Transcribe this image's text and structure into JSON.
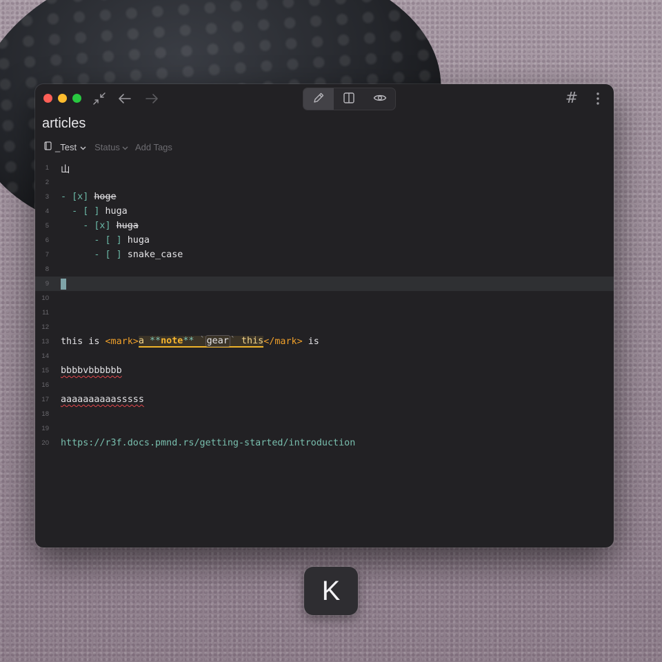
{
  "window": {
    "title": "articles"
  },
  "toolbar": {
    "icons": [
      "collapse-icon",
      "back-arrow-icon",
      "forward-arrow-icon",
      "pencil-icon",
      "split-view-icon",
      "eye-icon",
      "hashtag-icon",
      "more-vertical-icon"
    ],
    "hash_glyph": "#"
  },
  "meta": {
    "notebook": "_Test",
    "status": "Status",
    "tags": "Add Tags"
  },
  "editor": {
    "line_numbers": [
      "1",
      "2",
      "3",
      "4",
      "5",
      "6",
      "7",
      "8",
      "9",
      "10",
      "11",
      "12",
      "13",
      "14",
      "15",
      "16",
      "17",
      "18",
      "19",
      "20"
    ],
    "l1": "山",
    "l3": {
      "dash": "- ",
      "box": "[x]",
      "sp": " ",
      "text": "hoge"
    },
    "l4": {
      "indent": "  ",
      "dash": "- ",
      "box": "[ ]",
      "sp": " ",
      "text": "huga"
    },
    "l5": {
      "indent": "    ",
      "dash": "- ",
      "box": "[x]",
      "sp": " ",
      "text": "huga"
    },
    "l6": {
      "indent": "      ",
      "dash": "- ",
      "box": "[ ]",
      "sp": " ",
      "text": "huga"
    },
    "l7": {
      "indent": "      ",
      "dash": "- ",
      "box": "[ ]",
      "sp": " ",
      "text": "snake_case"
    },
    "l13": {
      "pre": "this is ",
      "open_tag": "<mark>",
      "a": "a ",
      "stars_open": "**",
      "bold": "note",
      "stars_close": "**",
      "sp1": " ",
      "tick_open": "`",
      "code": "gear",
      "tick_close": "`",
      "sp2": " this",
      "close_tag": "</mark>",
      "post": " is"
    },
    "l15": "bbbbvbbbbbb",
    "l17": "aaaaaaaaaasssss",
    "l20": "https://r3f.docs.pmnd.rs/getting-started/introduction"
  },
  "keycap": {
    "label": "K"
  },
  "colors": {
    "accent": "#f0b429",
    "link": "#79bfae",
    "background": "#222124"
  }
}
